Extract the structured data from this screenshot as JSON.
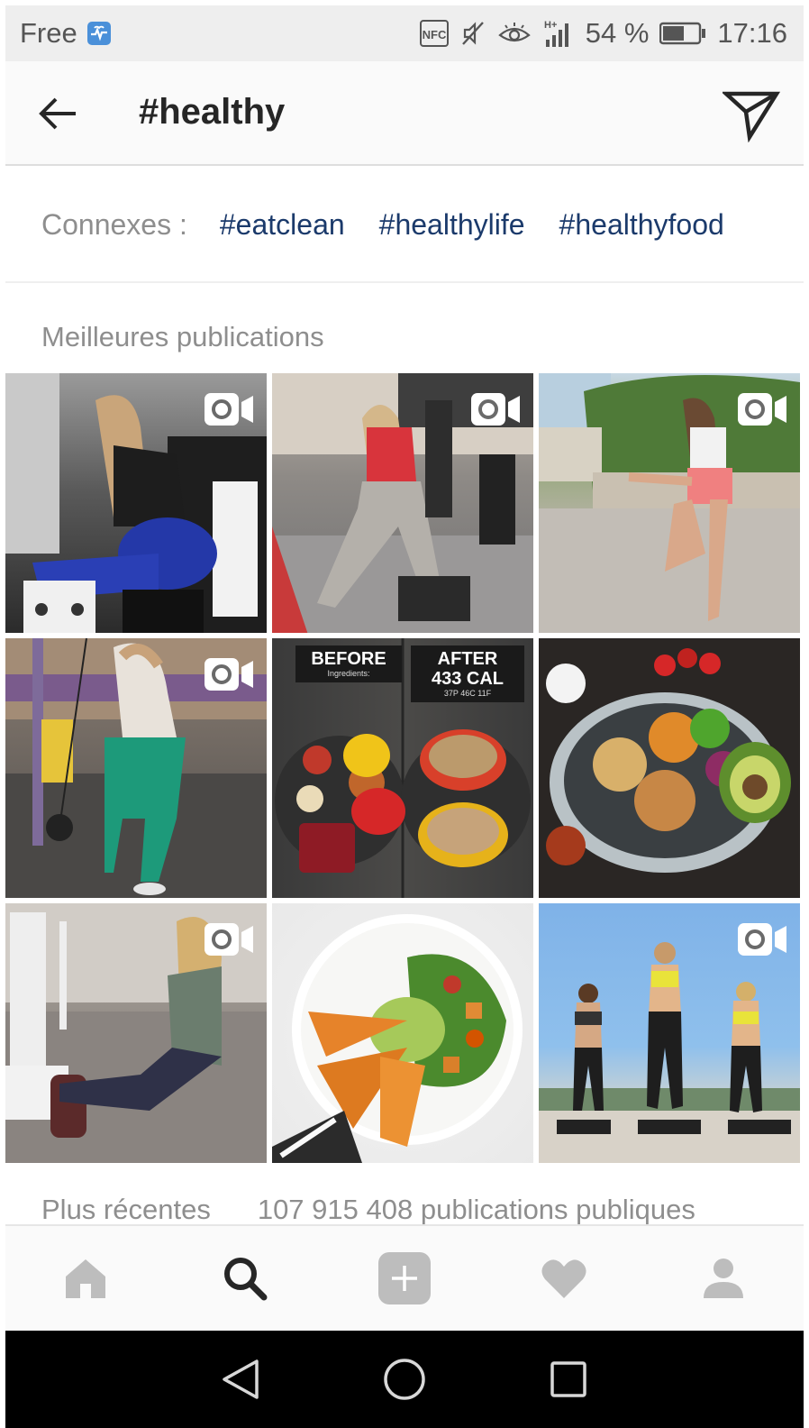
{
  "status_bar": {
    "carrier": "Free",
    "nfc": "NFC",
    "signal": "H+",
    "battery": "54 %",
    "time": "17:16"
  },
  "header": {
    "title": "#healthy",
    "back_icon": "arrow-left-icon",
    "direct_icon": "paper-plane-icon"
  },
  "related": {
    "label": "Connexes :",
    "tags": [
      "#eatclean",
      "#healthylife",
      "#healthyfood"
    ]
  },
  "top_posts": {
    "title": "Meilleures publications",
    "tiles": [
      {
        "scene": "gym-hip-thrust",
        "video": true
      },
      {
        "scene": "gym-step-lunge",
        "video": true
      },
      {
        "scene": "outdoor-band-exercise",
        "video": true
      },
      {
        "scene": "gym-cable-kickback",
        "video": true
      },
      {
        "scene": "before-after-stuffed-peppers",
        "video": false
      },
      {
        "scene": "chicken-chickpea-bowl",
        "video": false
      },
      {
        "scene": "gym-machine-exercise",
        "video": true
      },
      {
        "scene": "salad-sweet-potato-fries",
        "video": false
      },
      {
        "scene": "rooftop-jumping-group",
        "video": true
      }
    ],
    "before_label": "BEFORE",
    "ingredients_label": "Ingredients:",
    "after_label": "AFTER",
    "calories": "433 CAL",
    "macros": "37P 46C 11F"
  },
  "recent": {
    "label": "Plus récentes",
    "count_text": "107 915 408 publications publiques"
  },
  "tab_bar": {
    "items": [
      "home-icon",
      "search-icon",
      "add-post-icon",
      "heart-icon",
      "profile-icon"
    ],
    "active": "search-icon"
  },
  "nav_bar": {
    "items": [
      "back-triangle-icon",
      "home-circle-icon",
      "recents-square-icon"
    ]
  },
  "colors": {
    "tag_blue": "#1b3a6b",
    "muted_gray": "#8e8e8e",
    "status_bg": "#eeeeee"
  }
}
